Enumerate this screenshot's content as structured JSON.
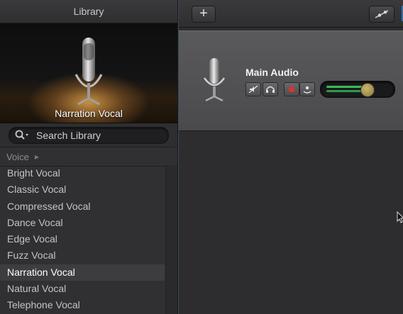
{
  "library": {
    "title": "Library",
    "preview_caption": "Narration Vocal",
    "search_placeholder": "Search Library",
    "category": "Voice",
    "patches": [
      {
        "label": "Bright Vocal",
        "selected": false
      },
      {
        "label": "Classic Vocal",
        "selected": false
      },
      {
        "label": "Compressed Vocal",
        "selected": false
      },
      {
        "label": "Dance Vocal",
        "selected": false
      },
      {
        "label": "Edge Vocal",
        "selected": false
      },
      {
        "label": "Fuzz Vocal",
        "selected": false
      },
      {
        "label": "Narration Vocal",
        "selected": true
      },
      {
        "label": "Natural Vocal",
        "selected": false
      },
      {
        "label": "Telephone Vocal",
        "selected": false
      }
    ]
  },
  "toolbar": {
    "add_label": "+"
  },
  "track": {
    "name": "Main Audio",
    "volume_level": 0.68
  },
  "colors": {
    "record": "#e03030",
    "meter": "#3dbb5a",
    "selection": "#3d3d40"
  }
}
